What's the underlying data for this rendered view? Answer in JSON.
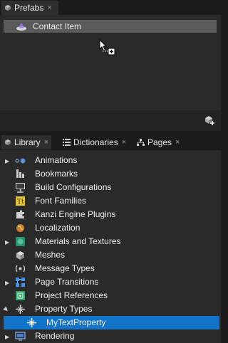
{
  "prefabs": {
    "tab_label": "Prefabs",
    "close_glyph": "×",
    "items": [
      {
        "label": "Contact Item",
        "icon": "prefab-icon"
      }
    ]
  },
  "library_tabs": {
    "library": "Library",
    "dictionaries": "Dictionaries",
    "pages": "Pages",
    "close_glyph": "×"
  },
  "library_items": [
    {
      "label": "Animations",
      "icon": "animations-icon",
      "expandable": true,
      "expanded": false
    },
    {
      "label": "Bookmarks",
      "icon": "bookmarks-icon",
      "expandable": false
    },
    {
      "label": "Build Configurations",
      "icon": "build-configurations-icon",
      "expandable": false
    },
    {
      "label": "Font Families",
      "icon": "font-families-icon",
      "expandable": false
    },
    {
      "label": "Kanzi Engine Plugins",
      "icon": "kanzi-engine-plugins-icon",
      "expandable": false
    },
    {
      "label": "Localization",
      "icon": "localization-icon",
      "expandable": false
    },
    {
      "label": "Materials and Textures",
      "icon": "materials-icon",
      "expandable": true,
      "expanded": false
    },
    {
      "label": "Meshes",
      "icon": "meshes-icon",
      "expandable": false
    },
    {
      "label": "Message Types",
      "icon": "message-types-icon",
      "expandable": false
    },
    {
      "label": "Page Transitions",
      "icon": "page-transitions-icon",
      "expandable": true,
      "expanded": false
    },
    {
      "label": "Project References",
      "icon": "project-references-icon",
      "expandable": false
    },
    {
      "label": "Property Types",
      "icon": "property-types-icon",
      "expandable": true,
      "expanded": true
    },
    {
      "label": "MyTextProperty",
      "icon": "property-type-icon",
      "child": true,
      "selected": true
    },
    {
      "label": "Rendering",
      "icon": "rendering-icon",
      "expandable": true,
      "expanded": false
    }
  ],
  "colors": {
    "selection": "#1174c9",
    "panel": "#2a2a2a",
    "background": "#1b1b1b"
  }
}
